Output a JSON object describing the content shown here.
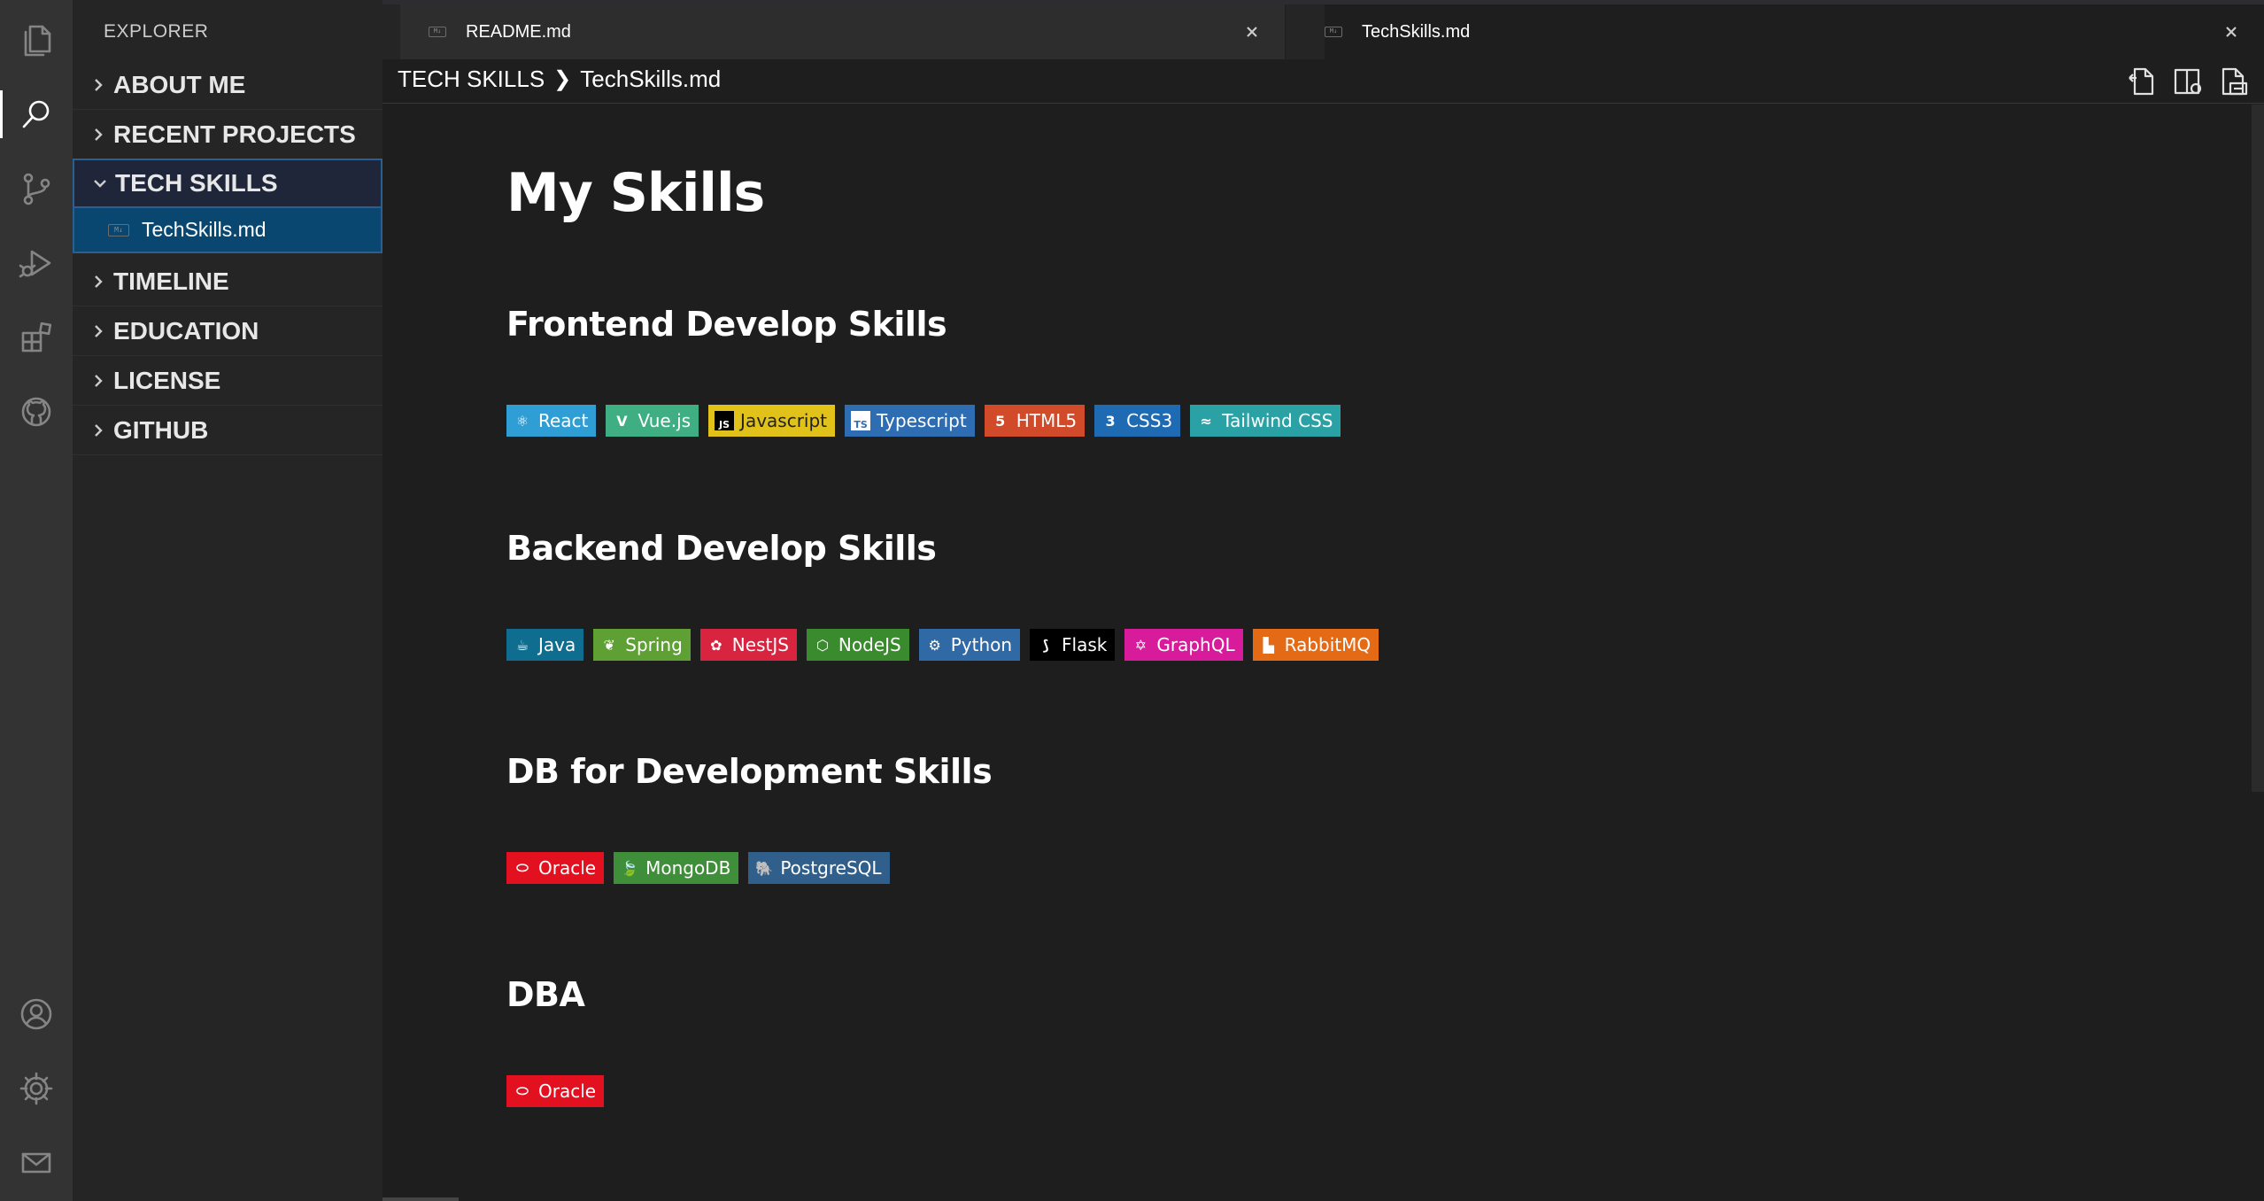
{
  "sidebar": {
    "title": "EXPLORER",
    "sections": [
      {
        "label": "ABOUT ME",
        "open": false
      },
      {
        "label": "RECENT PROJECTS",
        "open": false
      },
      {
        "label": "TECH SKILLS",
        "open": true
      },
      {
        "label": "TIMELINE",
        "open": false
      },
      {
        "label": "EDUCATION",
        "open": false
      },
      {
        "label": "LICENSE",
        "open": false
      },
      {
        "label": "GITHUB",
        "open": false
      }
    ],
    "active_file": "TechSkills.md",
    "file_icon_text": "M↓"
  },
  "activity_bar": {
    "top": [
      "files-icon",
      "search-icon",
      "source-control-icon",
      "run-debug-icon",
      "extensions-icon",
      "github-icon"
    ],
    "bottom": [
      "account-icon",
      "settings-gear-icon",
      "mail-icon"
    ],
    "active": "search-icon"
  },
  "tabs": [
    {
      "label": "README.md",
      "active": false
    },
    {
      "label": "TechSkills.md",
      "active": true
    }
  ],
  "breadcrumb": {
    "section": "TECH SKILLS",
    "separator": "❯",
    "file": "TechSkills.md"
  },
  "toolbar_icons": [
    "open-preview-icon",
    "split-editor-icon",
    "show-source-icon"
  ],
  "content": {
    "title": "My Skills",
    "sections": [
      {
        "heading": "Frontend Develop Skills",
        "badges": [
          {
            "label": "React",
            "bg": "#2f9ed4",
            "icon": "react-icon",
            "glyph": "⚛"
          },
          {
            "label": "Vue.js",
            "bg": "#3fae82",
            "icon": "vue-icon",
            "glyph": "V"
          },
          {
            "label": "Javascript",
            "bg": "#e0c21b",
            "icon": "javascript-icon",
            "glyph": "JS",
            "dark_text": true
          },
          {
            "label": "Typescript",
            "bg": "#2f6db3",
            "icon": "typescript-icon",
            "glyph": "TS"
          },
          {
            "label": "HTML5",
            "bg": "#d14a2a",
            "icon": "html5-icon",
            "glyph": "5"
          },
          {
            "label": "CSS3",
            "bg": "#1f6bb3",
            "icon": "css3-icon",
            "glyph": "3"
          },
          {
            "label": "Tailwind CSS",
            "bg": "#2aa1a4",
            "icon": "tailwind-icon",
            "glyph": "≈"
          }
        ]
      },
      {
        "heading": "Backend Develop Skills",
        "badges": [
          {
            "label": "Java",
            "bg": "#0f6d8f",
            "icon": "java-icon",
            "glyph": "☕"
          },
          {
            "label": "Spring",
            "bg": "#5ea033",
            "icon": "spring-icon",
            "glyph": "❦"
          },
          {
            "label": "NestJS",
            "bg": "#d9243f",
            "icon": "nestjs-icon",
            "glyph": "✿"
          },
          {
            "label": "NodeJS",
            "bg": "#3a8a2e",
            "icon": "nodejs-icon",
            "glyph": "⬡"
          },
          {
            "label": "Python",
            "bg": "#2f6aa6",
            "icon": "python-icon",
            "glyph": "⚙"
          },
          {
            "label": "Flask",
            "bg": "#000000",
            "icon": "flask-icon",
            "glyph": "⟆"
          },
          {
            "label": "GraphQL",
            "bg": "#d81b9b",
            "icon": "graphql-icon",
            "glyph": "✡"
          },
          {
            "label": "RabbitMQ",
            "bg": "#e46a16",
            "icon": "rabbitmq-icon",
            "glyph": "▙"
          }
        ]
      },
      {
        "heading": "DB for Development Skills",
        "badges": [
          {
            "label": "Oracle",
            "bg": "#e3101f",
            "icon": "oracle-icon",
            "glyph": "⬭"
          },
          {
            "label": "MongoDB",
            "bg": "#3f8f3a",
            "icon": "mongodb-icon",
            "glyph": "🍃"
          },
          {
            "label": "PostgreSQL",
            "bg": "#2f5f8a",
            "icon": "postgresql-icon",
            "glyph": "🐘"
          }
        ]
      },
      {
        "heading": "DBA",
        "badges": [
          {
            "label": "Oracle",
            "bg": "#e3101f",
            "icon": "oracle-icon",
            "glyph": "⬭"
          }
        ]
      }
    ]
  }
}
